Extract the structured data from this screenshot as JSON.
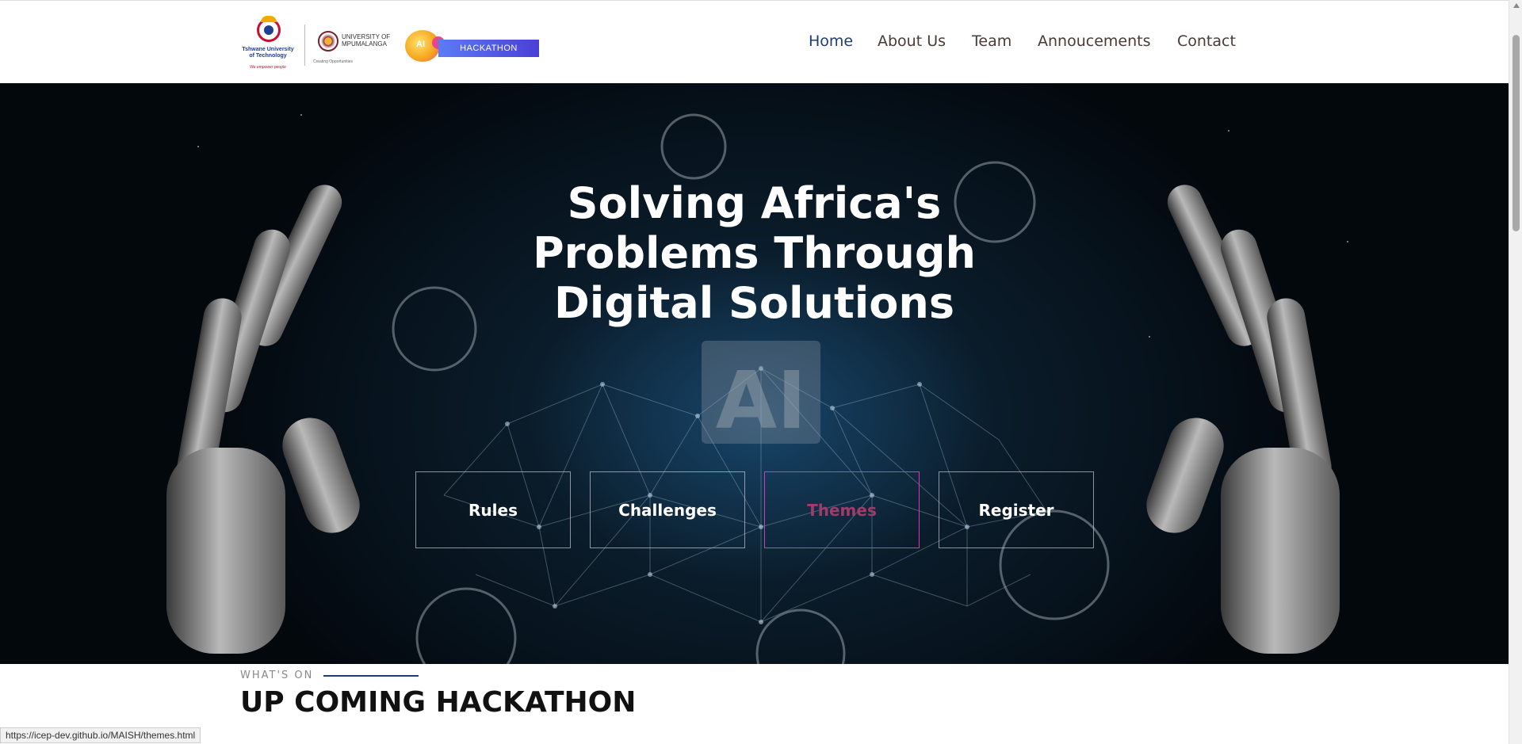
{
  "brand": {
    "tut_name": "Tshwane University of Technology",
    "tut_tagline": "We empower people",
    "ump_name": "UNIVERSITY OF MPUMALANGA",
    "ump_tagline": "Creating Opportunities",
    "hack_ai": "AI",
    "hack_label": "HACKATHON"
  },
  "nav": {
    "items": [
      {
        "label": "Home",
        "active": true
      },
      {
        "label": "About Us"
      },
      {
        "label": "Team"
      },
      {
        "label": "Annoucements"
      },
      {
        "label": "Contact"
      }
    ]
  },
  "hero": {
    "title_line1": "Solving Africa's",
    "title_line2": "Problems Through",
    "title_line3": "Digital Solutions",
    "buttons": [
      "Rules",
      "Challenges",
      "Themes",
      "Register"
    ]
  },
  "section": {
    "eyebrow": "WHAT'S ON",
    "title": "UP COMING HACKATHON"
  },
  "status_url": "https://icep-dev.github.io/MAISH/themes.html",
  "colors": {
    "nav_active": "#1c3d75",
    "nav_text": "#4a3a33",
    "hover_border": "#d13bb8"
  }
}
